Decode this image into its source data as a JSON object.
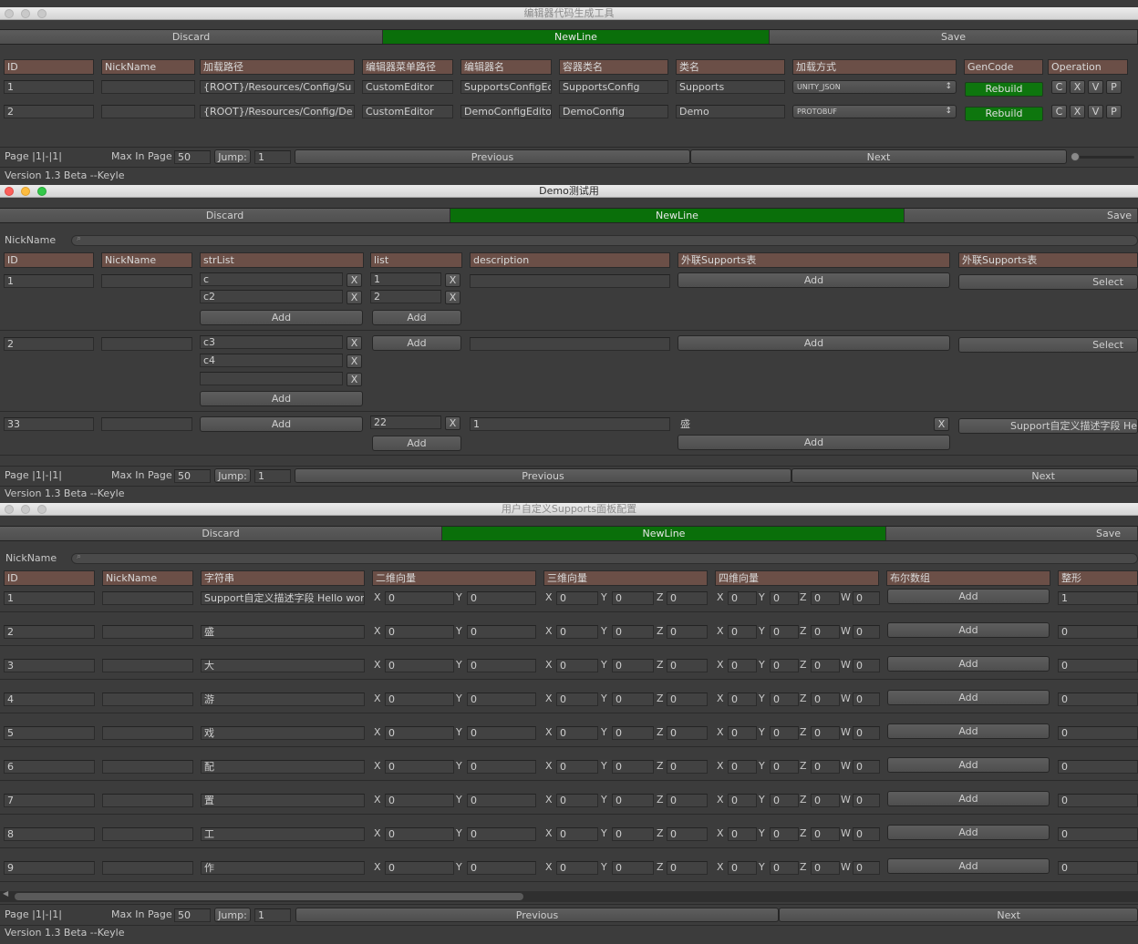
{
  "w1": {
    "title": "编辑器代码生成工具",
    "toolbar": {
      "discard": "Discard",
      "newline": "NewLine",
      "save": "Save"
    },
    "headers": [
      "ID",
      "NickName",
      "加载路径",
      "编辑器菜单路径",
      "编辑器名",
      "容器类名",
      "类名",
      "加载方式",
      "GenCode",
      "Operation"
    ],
    "rows": [
      {
        "id": "1",
        "nick": "",
        "path": "{ROOT}/Resources/Config/Su",
        "menu": "CustomEditor",
        "editor": "SupportsConfigEc",
        "container": "SupportsConfig",
        "cls": "Supports",
        "load": "UNITY_JSON",
        "gen": "Rebuild",
        "ops": [
          "C",
          "X",
          "V",
          "P"
        ]
      },
      {
        "id": "2",
        "nick": "",
        "path": "{ROOT}/Resources/Config/De",
        "menu": "CustomEditor",
        "editor": "DemoConfigEdito",
        "container": "DemoConfig",
        "cls": "Demo",
        "load": "PROTOBUF",
        "gen": "Rebuild",
        "ops": [
          "C",
          "X",
          "V",
          "P"
        ]
      }
    ],
    "footer": {
      "page": "Page |1|-|1|",
      "max_label": "Max In Page",
      "max_value": "50",
      "jump_label": "Jump:",
      "jump_value": "1",
      "prev": "Previous",
      "next": "Next",
      "version": "Version 1.3 Beta   --Keyle"
    }
  },
  "w2": {
    "title": "Demo测试用",
    "toolbar": {
      "discard": "Discard",
      "newline": "NewLine",
      "save": "Save"
    },
    "search_label": "NickName",
    "headers": [
      "ID",
      "NickName",
      "strList",
      "list",
      "description",
      "外联Supports表",
      "外联Supports表"
    ],
    "rows": [
      {
        "id": "1",
        "nick": "",
        "strList": [
          "c",
          "c2"
        ],
        "list": [
          "1",
          "2"
        ],
        "description": "",
        "link1": "Add",
        "link2": "Select"
      },
      {
        "id": "2",
        "nick": "",
        "strList": [
          "c3",
          "c4",
          ""
        ],
        "list": [],
        "description": "",
        "link1": "Add",
        "link2": "Select"
      },
      {
        "id": "33",
        "nick": "",
        "strList": [],
        "list": [
          "22"
        ],
        "description": "1",
        "link1_value": "盛",
        "link1": "Add",
        "link2": "Support自定义描述字段 He"
      }
    ],
    "add_label": "Add",
    "x_label": "X",
    "footer": {
      "page": "Page |1|-|1|",
      "max_label": "Max In Page",
      "max_value": "50",
      "jump_label": "Jump:",
      "jump_value": "1",
      "prev": "Previous",
      "next": "Next",
      "version": "Version 1.3 Beta   --Keyle"
    }
  },
  "w3": {
    "title": "用户自定义Supports面板配置",
    "toolbar": {
      "discard": "Discard",
      "newline": "NewLine",
      "save": "Save"
    },
    "search_label": "NickName",
    "headers": [
      "ID",
      "NickName",
      "字符串",
      "二维向量",
      "三维向量",
      "四维向量",
      "布尔数组",
      "整形"
    ],
    "axis": {
      "x": "X",
      "y": "Y",
      "z": "Z",
      "w": "W"
    },
    "add_label": "Add",
    "rows": [
      {
        "id": "1",
        "nick": "",
        "str": "Support自定义描述字段 Hello wor",
        "v2": [
          "0",
          "0"
        ],
        "v3": [
          "0",
          "0",
          "0"
        ],
        "v4": [
          "0",
          "0",
          "0",
          "0"
        ],
        "int": "1"
      },
      {
        "id": "2",
        "nick": "",
        "str": "盛",
        "v2": [
          "0",
          "0"
        ],
        "v3": [
          "0",
          "0",
          "0"
        ],
        "v4": [
          "0",
          "0",
          "0",
          "0"
        ],
        "int": "0"
      },
      {
        "id": "3",
        "nick": "",
        "str": "大",
        "v2": [
          "0",
          "0"
        ],
        "v3": [
          "0",
          "0",
          "0"
        ],
        "v4": [
          "0",
          "0",
          "0",
          "0"
        ],
        "int": "0"
      },
      {
        "id": "4",
        "nick": "",
        "str": "游",
        "v2": [
          "0",
          "0"
        ],
        "v3": [
          "0",
          "0",
          "0"
        ],
        "v4": [
          "0",
          "0",
          "0",
          "0"
        ],
        "int": "0"
      },
      {
        "id": "5",
        "nick": "",
        "str": "戏",
        "v2": [
          "0",
          "0"
        ],
        "v3": [
          "0",
          "0",
          "0"
        ],
        "v4": [
          "0",
          "0",
          "0",
          "0"
        ],
        "int": "0"
      },
      {
        "id": "6",
        "nick": "",
        "str": "配",
        "v2": [
          "0",
          "0"
        ],
        "v3": [
          "0",
          "0",
          "0"
        ],
        "v4": [
          "0",
          "0",
          "0",
          "0"
        ],
        "int": "0"
      },
      {
        "id": "7",
        "nick": "",
        "str": "置",
        "v2": [
          "0",
          "0"
        ],
        "v3": [
          "0",
          "0",
          "0"
        ],
        "v4": [
          "0",
          "0",
          "0",
          "0"
        ],
        "int": "0"
      },
      {
        "id": "8",
        "nick": "",
        "str": "工",
        "v2": [
          "0",
          "0"
        ],
        "v3": [
          "0",
          "0",
          "0"
        ],
        "v4": [
          "0",
          "0",
          "0",
          "0"
        ],
        "int": "0"
      },
      {
        "id": "9",
        "nick": "",
        "str": "作",
        "v2": [
          "0",
          "0"
        ],
        "v3": [
          "0",
          "0",
          "0"
        ],
        "v4": [
          "0",
          "0",
          "0",
          "0"
        ],
        "int": "0"
      }
    ],
    "footer": {
      "page": "Page |1|-|1|",
      "max_label": "Max In Page",
      "max_value": "50",
      "jump_label": "Jump:",
      "jump_value": "1",
      "prev": "Previous",
      "next": "Next",
      "version": "Version 1.3 Beta   --Keyle"
    }
  }
}
